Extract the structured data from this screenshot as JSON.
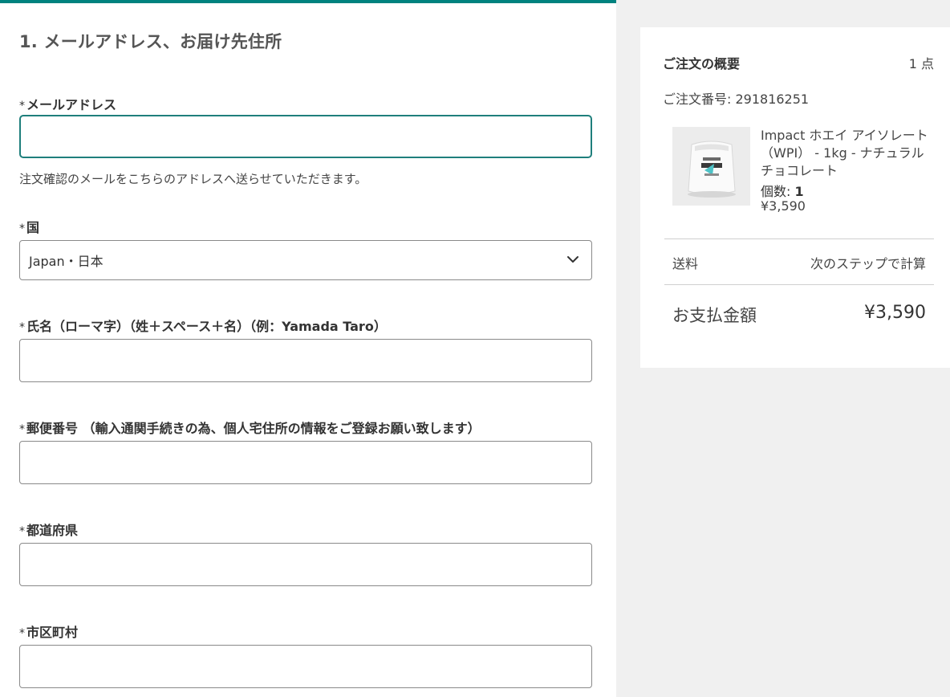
{
  "form": {
    "section_title": "1. メールアドレス、お届け先住所",
    "required_mark": "*",
    "email": {
      "label": "メールアドレス",
      "value": "",
      "helper": "注文確認のメールをこちらのアドレスへ送らせていただきます。"
    },
    "country": {
      "label": "国",
      "selected": "Japan・日本"
    },
    "name": {
      "label": "氏名（ローマ字）（姓＋スペース＋名）（例：Yamada Taro）",
      "value": ""
    },
    "postal": {
      "label": "郵便番号 （輸入通関手続きの為、個人宅住所の情報をご登録お願い致します）",
      "value": ""
    },
    "prefecture": {
      "label": "都道府県",
      "value": ""
    },
    "city": {
      "label": "市区町村",
      "value": ""
    }
  },
  "summary": {
    "title": "ご注文の概要",
    "item_count": "1 点",
    "order_number": "ご注文番号:  291816251",
    "product": {
      "name": "Impact ホエイ アイソレート （WPI） - 1kg - ナチュラルチョコレート",
      "qty_label": "個数: ",
      "qty_value": "1",
      "price": "¥3,590"
    },
    "shipping_label": "送料",
    "shipping_value": "次のステップで計算",
    "total_label": "お支払金額",
    "total_value": "¥3,590"
  },
  "colors": {
    "accent": "#00827f",
    "focus_border": "#1f7f7c",
    "page_background": "#f0f0f0"
  }
}
